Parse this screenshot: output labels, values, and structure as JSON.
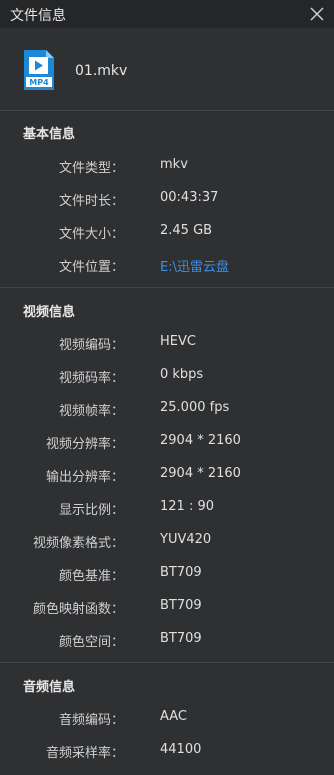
{
  "window": {
    "title": "文件信息"
  },
  "file": {
    "name": "01.mkv",
    "icon": "mp4-file-icon",
    "icon_label": "MP4"
  },
  "sections": [
    {
      "title": "基本信息",
      "rows": [
        {
          "label": "文件类型：",
          "value": "mkv"
        },
        {
          "label": "文件时长：",
          "value": "00:43:37"
        },
        {
          "label": "文件大小：",
          "value": "2.45 GB"
        },
        {
          "label": "文件位置：",
          "value": "E:\\迅雷云盘"
        }
      ]
    },
    {
      "title": "视频信息",
      "rows": [
        {
          "label": "视频编码：",
          "value": "HEVC"
        },
        {
          "label": "视频码率：",
          "value": "0 kbps"
        },
        {
          "label": "视频帧率：",
          "value": "25.000 fps"
        },
        {
          "label": "视频分辨率：",
          "value": "2904 * 2160"
        },
        {
          "label": "输出分辨率：",
          "value": "2904 * 2160"
        },
        {
          "label": "显示比例：",
          "value": "121 : 90"
        },
        {
          "label": "视频像素格式：",
          "value": "YUV420"
        },
        {
          "label": "颜色基准：",
          "value": "BT709"
        },
        {
          "label": "颜色映射函数：",
          "value": "BT709"
        },
        {
          "label": "颜色空间：",
          "value": "BT709"
        }
      ]
    },
    {
      "title": "音频信息",
      "rows": [
        {
          "label": "音频编码：",
          "value": "AAC"
        },
        {
          "label": "音频采样率：",
          "value": "44100"
        }
      ]
    }
  ],
  "colors": {
    "background": "#2f3032",
    "titlebar": "#252628",
    "link": "#3a8ee6",
    "icon": "#1e88d6"
  }
}
